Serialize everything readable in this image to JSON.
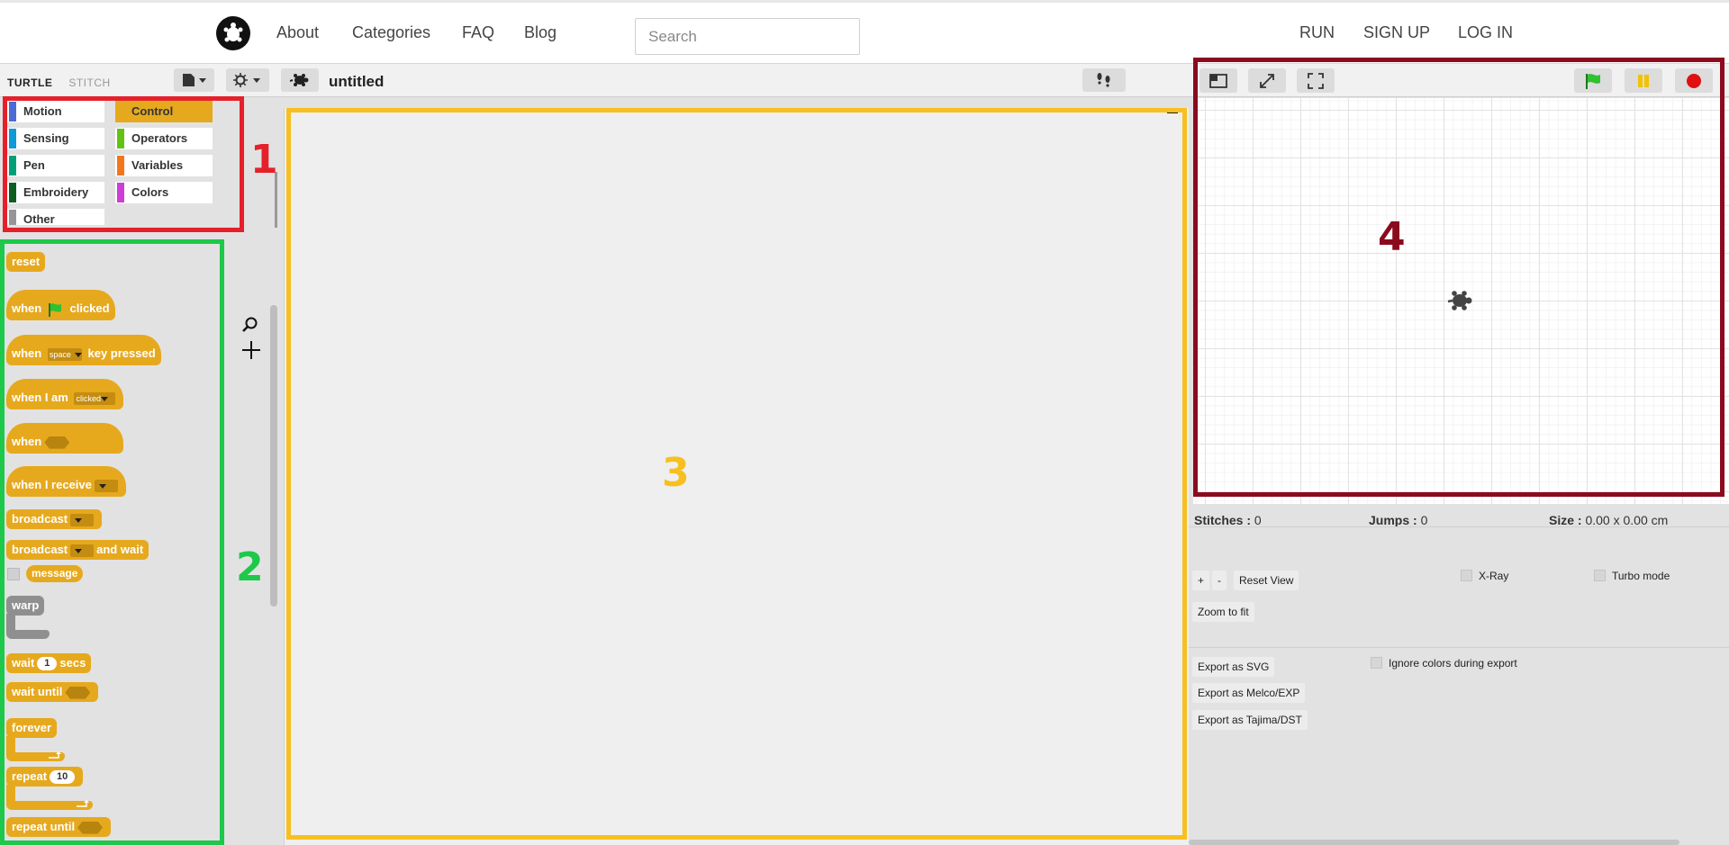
{
  "topnav": {
    "links": [
      "About",
      "Categories",
      "FAQ",
      "Blog"
    ],
    "search_placeholder": "Search",
    "right_links": [
      "RUN",
      "SIGN UP",
      "LOG IN"
    ]
  },
  "ide": {
    "logo_turtle": "TURTLE",
    "logo_stitch": "STITCH",
    "project_name": "untitled",
    "categories": [
      {
        "label": "Motion",
        "color": "#4a6cd4"
      },
      {
        "label": "Control",
        "color": "#e6a91e",
        "active": true
      },
      {
        "label": "Sensing",
        "color": "#0e9ad6"
      },
      {
        "label": "Operators",
        "color": "#62c213"
      },
      {
        "label": "Pen",
        "color": "#00a178"
      },
      {
        "label": "Variables",
        "color": "#f3761d"
      },
      {
        "label": "Embroidery",
        "color": "#0b5e1e"
      },
      {
        "label": "Colors",
        "color": "#cc3ed6"
      },
      {
        "label": "Other",
        "color": "#969696"
      }
    ],
    "blocks": {
      "reset": "reset",
      "when": "when",
      "clicked": "clicked",
      "space": "space",
      "key_pressed": "key pressed",
      "when_i_am": "when I am",
      "clicked_opt": "clicked",
      "when_i_receive": "when I receive",
      "broadcast": "broadcast",
      "and_wait": "and wait",
      "message": "message",
      "warp": "warp",
      "wait": "wait",
      "wait_value": "1",
      "secs": "secs",
      "wait_until": "wait until",
      "forever": "forever",
      "repeat": "repeat",
      "repeat_value": "10",
      "repeat_until": "repeat until"
    }
  },
  "info": {
    "stitches_label": "Stitches :",
    "stitches_value": "0",
    "jumps_label": "Jumps :",
    "jumps_value": "0",
    "size_label": "Size :",
    "size_value": "0.00 x 0.00 cm",
    "plus": "+",
    "minus": "-",
    "reset_view": "Reset View",
    "zoom_fit": "Zoom to fit",
    "xray": "X-Ray",
    "turbo": "Turbo mode",
    "export_svg": "Export as SVG",
    "export_exp": "Export as Melco/EXP",
    "export_dst": "Export as Tajima/DST",
    "ignore_colors": "Ignore colors during export"
  },
  "annotations": [
    {
      "label": "1",
      "color": "#e5202a"
    },
    {
      "label": "2",
      "color": "#1ec84a"
    },
    {
      "label": "3",
      "color": "#f7c020"
    },
    {
      "label": "4",
      "color": "#8b0a1e"
    }
  ]
}
